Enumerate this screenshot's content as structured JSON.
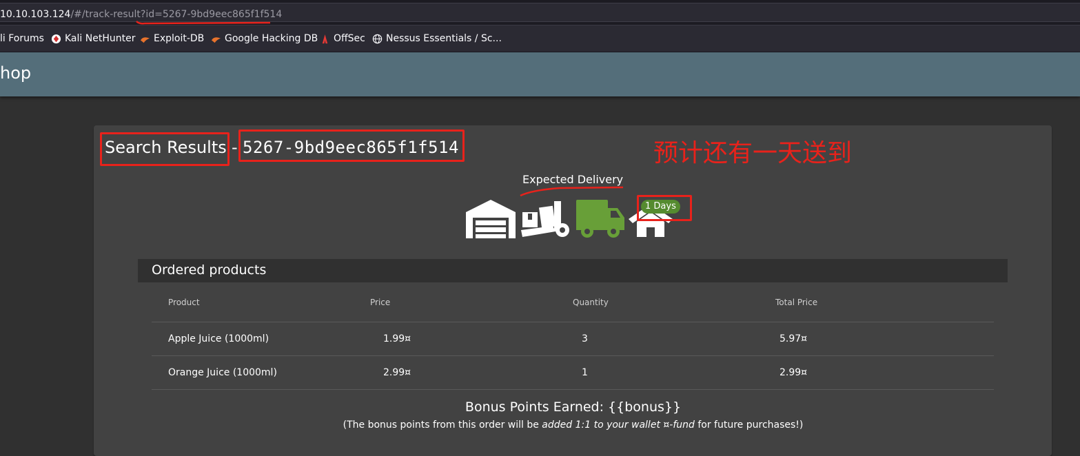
{
  "browser": {
    "url_host": "10.10.103.124",
    "url_path": "/#/track-result?id=5267-9bd9eec865f1f514",
    "bookmarks": [
      {
        "label": "li Forums",
        "icon": "kali-forums-icon"
      },
      {
        "label": "Kali NetHunter",
        "icon": "kali-nethunter-icon"
      },
      {
        "label": "Exploit-DB",
        "icon": "exploit-db-icon"
      },
      {
        "label": "Google Hacking DB",
        "icon": "google-hacking-db-icon"
      },
      {
        "label": "OffSec",
        "icon": "offsec-icon"
      },
      {
        "label": "Nessus Essentials / Sc...",
        "icon": "globe-icon"
      }
    ]
  },
  "toolbar": {
    "title": "hop"
  },
  "tracking": {
    "heading": "Search Results",
    "separator": "-",
    "order_id": "5267-9bd9eec865f1f514",
    "annotation": "预计还有一天送到",
    "expected_label": "Expected Delivery",
    "days_badge": "1 Days",
    "stage_icons": [
      "warehouse-icon",
      "dolly-icon",
      "truck-icon",
      "home-icon"
    ],
    "current_stage_color": "#689f38"
  },
  "products": {
    "title": "Ordered products",
    "columns": [
      "Product",
      "Price",
      "Quantity",
      "Total Price"
    ],
    "rows": [
      {
        "product": "Apple Juice (1000ml)",
        "price": "1.99¤",
        "quantity": "3",
        "total": "5.97¤"
      },
      {
        "product": "Orange Juice (1000ml)",
        "price": "2.99¤",
        "quantity": "1",
        "total": "2.99¤"
      }
    ]
  },
  "bonus": {
    "title": "Bonus Points Earned: {{bonus}}",
    "note_prefix": "(The bonus points from this order will be ",
    "note_emphasis": "added 1:1 to your wallet ¤-fund",
    "note_suffix": " for future purchases!)"
  },
  "colors": {
    "annotation_red": "#e8221b",
    "toolbar": "#546e7a",
    "card": "#424242",
    "badge_green": "#558b2f"
  }
}
